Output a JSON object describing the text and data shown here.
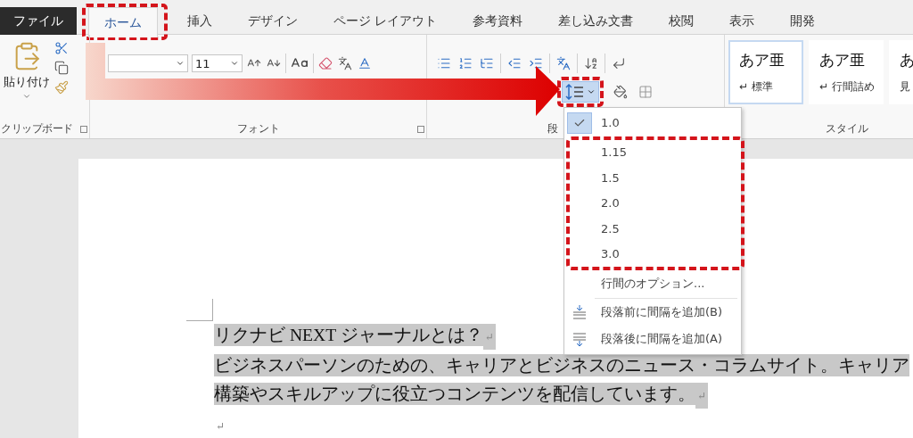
{
  "tabs": [
    {
      "label": "ファイル",
      "kind": "file",
      "selected": false,
      "highlighted": false
    },
    {
      "label": "ホーム",
      "kind": "tab",
      "selected": true,
      "highlighted": true
    },
    {
      "label": "挿入",
      "kind": "tab",
      "selected": false,
      "highlighted": false
    },
    {
      "label": "デザイン",
      "kind": "tab",
      "selected": false,
      "highlighted": false
    },
    {
      "label": "ページ レイアウト",
      "kind": "tab",
      "selected": false,
      "highlighted": false
    },
    {
      "label": "参考資料",
      "kind": "tab",
      "selected": false,
      "highlighted": false
    },
    {
      "label": "差し込み文書",
      "kind": "tab",
      "selected": false,
      "highlighted": false
    },
    {
      "label": "校閲",
      "kind": "tab",
      "selected": false,
      "highlighted": false
    },
    {
      "label": "表示",
      "kind": "tab",
      "selected": false,
      "highlighted": false
    },
    {
      "label": "開発",
      "kind": "tab",
      "selected": false,
      "highlighted": false
    }
  ],
  "ribbon": {
    "clipboard": {
      "paste_label": "貼り付け",
      "group_label": "クリップボード"
    },
    "font": {
      "size": "11",
      "group_label": "フォント"
    },
    "paragraph": {
      "group_label": "段",
      "line_spacing_open": true,
      "line_spacing_highlighted": true
    },
    "styles": {
      "group_label": "スタイル",
      "items": [
        {
          "preview": "あア亜",
          "label": "↵ 標準",
          "selected": true
        },
        {
          "preview": "あア亜",
          "label": "↵ 行間詰め",
          "selected": false
        },
        {
          "preview": "あ",
          "label": "見",
          "selected": false
        }
      ]
    }
  },
  "line_spacing_menu": {
    "options": [
      {
        "label": "1.0",
        "checked": true,
        "highlighted": false
      },
      {
        "label": "1.15",
        "checked": false,
        "highlighted": true
      },
      {
        "label": "1.5",
        "checked": false,
        "highlighted": true
      },
      {
        "label": "2.0",
        "checked": false,
        "highlighted": true
      },
      {
        "label": "2.5",
        "checked": false,
        "highlighted": true
      },
      {
        "label": "3.0",
        "checked": false,
        "highlighted": true
      }
    ],
    "commands": [
      {
        "label": "行間のオプション...",
        "kind": "plain"
      },
      {
        "label": "段落前に間隔を追加(B)",
        "kind": "space_before"
      },
      {
        "label": "段落後に間隔を追加(A)",
        "kind": "space_after"
      }
    ]
  },
  "annotations": {
    "pointer_arrow": true
  },
  "document": {
    "paragraphs": [
      {
        "lines": [
          "リクナビ NEXT ジャーナルとは？"
        ],
        "mark": "↵",
        "selected": true
      },
      {
        "lines": [
          "ビジネスパーソンのための、キャリアとビジネスのニュース・コラムサイト。キャリア",
          "構築やスキルアップに役立つコンテンツを配信しています。"
        ],
        "mark": "↵",
        "selected": true
      },
      {
        "mark": "↵",
        "selected": false
      }
    ]
  }
}
